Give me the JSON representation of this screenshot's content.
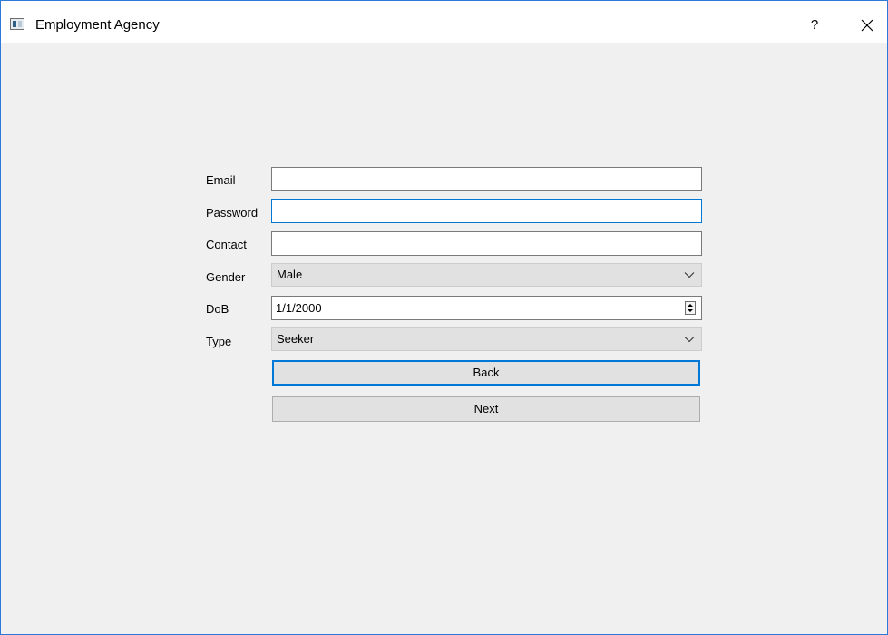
{
  "window": {
    "title": "Employment Agency",
    "help_label": "?",
    "close_icon": "close-icon",
    "app_icon": "window-app-icon"
  },
  "form": {
    "email": {
      "label": "Email",
      "value": ""
    },
    "password": {
      "label": "Password",
      "value": ""
    },
    "contact": {
      "label": "Contact",
      "value": ""
    },
    "gender": {
      "label": "Gender",
      "selected": "Male"
    },
    "dob": {
      "label": "DoB",
      "value": "1/1/2000"
    },
    "type": {
      "label": "Type",
      "selected": "Seeker"
    }
  },
  "buttons": {
    "back": "Back",
    "next": "Next"
  },
  "colors": {
    "focus_accent": "#0078d7",
    "window_border": "#2b79d8",
    "background": "#f0f0f0"
  }
}
